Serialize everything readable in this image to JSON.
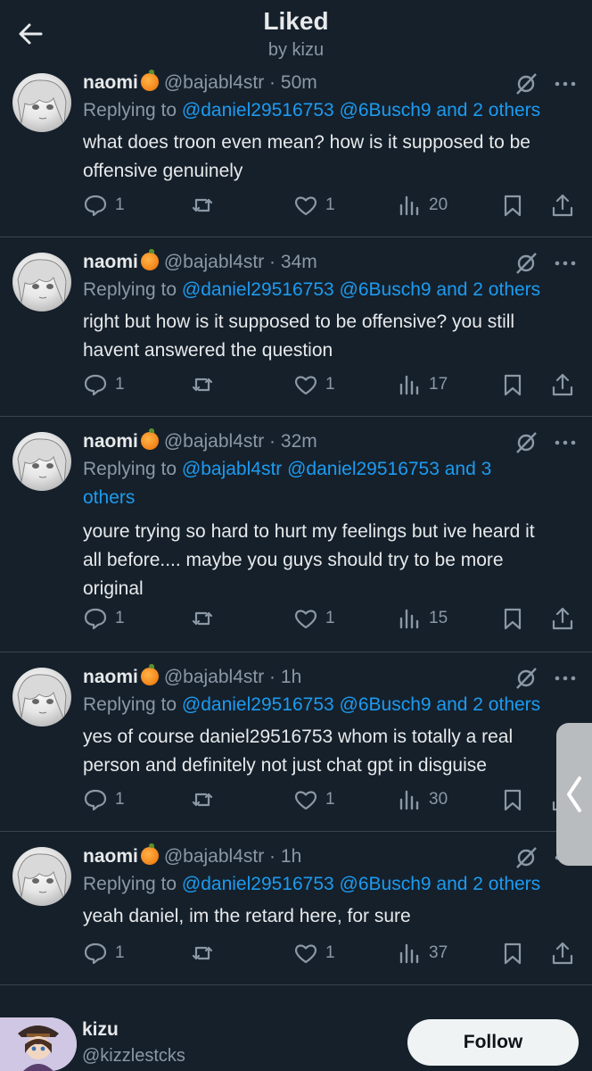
{
  "header": {
    "title": "Liked",
    "subtitle": "by kizu"
  },
  "tweets": [
    {
      "name": "naomi",
      "handle": "@bajabl4str",
      "time": "50m",
      "replying_prefix": "Replying to",
      "mentions": "@daniel29516753 @6Busch9 and 2 others",
      "mentions_line2": "",
      "text_lines": [
        "what does troon even mean? how is it supposed to be",
        "offensive genuinely",
        ""
      ],
      "replies": "1",
      "likes": "1",
      "views": "20"
    },
    {
      "name": "naomi",
      "handle": "@bajabl4str",
      "time": "34m",
      "replying_prefix": "Replying to",
      "mentions": "@daniel29516753 @6Busch9 and 2 others",
      "mentions_line2": "",
      "text_lines": [
        "right but how is it supposed to be offensive? you still",
        "havent answered the question",
        ""
      ],
      "replies": "1",
      "likes": "1",
      "views": "17"
    },
    {
      "name": "naomi",
      "handle": "@bajabl4str",
      "time": "32m",
      "replying_prefix": "Replying to",
      "mentions": "@bajabl4str @daniel29516753 and 3",
      "mentions_line2": "others",
      "text_lines": [
        "youre trying so hard to hurt my feelings but ive heard it",
        "all before.... maybe you guys should try to be more",
        "original"
      ],
      "replies": "1",
      "likes": "1",
      "views": "15"
    },
    {
      "name": "naomi",
      "handle": "@bajabl4str",
      "time": "1h",
      "replying_prefix": "Replying to",
      "mentions": "@daniel29516753 @6Busch9 and 2 others",
      "mentions_line2": "",
      "text_lines": [
        "yes of course daniel29516753 whom is totally a real",
        "person and definitely not just chat gpt in disguise",
        ""
      ],
      "replies": "1",
      "likes": "1",
      "views": "30"
    },
    {
      "name": "naomi",
      "handle": "@bajabl4str",
      "time": "1h",
      "replying_prefix": "Replying to",
      "mentions": "@daniel29516753 @6Busch9 and 2 others",
      "mentions_line2": "",
      "text_lines": [
        "yeah daniel, im the retard here, for sure",
        "",
        ""
      ],
      "replies": "1",
      "likes": "1",
      "views": "37"
    }
  ],
  "footer": {
    "name": "kizu",
    "handle": "@kizzlestcks",
    "follow_label": "Follow"
  },
  "icons": [
    "back-arrow-icon",
    "orange-emoji-icon",
    "grok-icon",
    "more-icon",
    "reply-icon",
    "retweet-icon",
    "like-icon",
    "views-icon",
    "bookmark-icon",
    "share-icon",
    "chevron-left-icon"
  ],
  "colors": {
    "background": "#15202b",
    "text": "#e7e9ea",
    "secondary": "#8b98a5",
    "accent": "#1d9bf0",
    "divider": "#38444d"
  }
}
